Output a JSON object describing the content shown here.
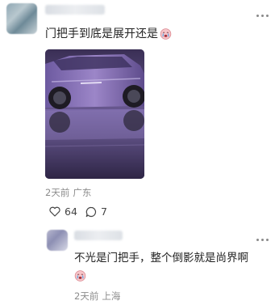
{
  "comments": [
    {
      "text": "门把手到底是展开还是",
      "time": "2天前",
      "location": "广东",
      "likes": "64",
      "replies": "7",
      "image": "purple-suv-photo"
    },
    {
      "text": "不光是门把手，整个倒影就是尚界啊",
      "time": "2天前",
      "location": "上海"
    }
  ],
  "icons": {
    "more": "more-dots-icon",
    "like": "heart-outline-icon",
    "comment": "comment-bubble-icon",
    "emoji": "crying-face-emoji"
  },
  "colors": {
    "meta_text": "#8c8c8c",
    "main_text": "#222222",
    "car_purple": "#6f5a98"
  }
}
